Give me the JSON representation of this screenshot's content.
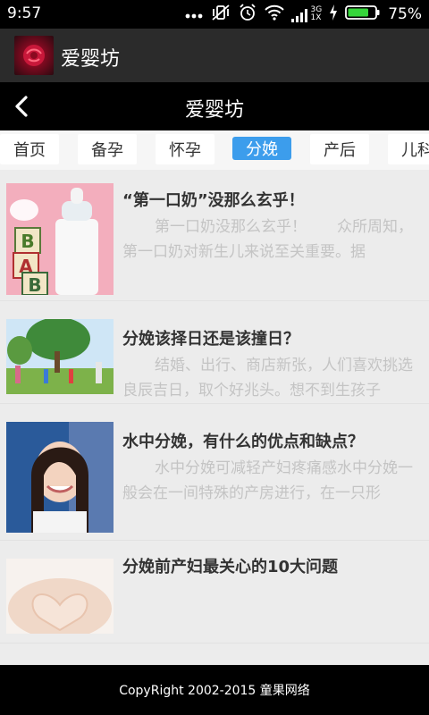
{
  "status_bar": {
    "time": "9:57",
    "battery_percent": "75%",
    "network_label_top": "3G",
    "network_label_bottom": "1X"
  },
  "app_bar": {
    "title": "爱婴坊"
  },
  "nav_bar": {
    "title": "爱婴坊"
  },
  "tabs": [
    {
      "label": "首页",
      "active": false
    },
    {
      "label": "备孕",
      "active": false
    },
    {
      "label": "怀孕",
      "active": false
    },
    {
      "label": "分娩",
      "active": true
    },
    {
      "label": "产后",
      "active": false
    },
    {
      "label": "儿科",
      "active": false
    }
  ],
  "articles": [
    {
      "title": "“第一口奶”没那么玄乎！",
      "desc": "第一口奶没那么玄乎！　　众所周知，第一口奶对新生儿来说至关重要。据",
      "image": "baby-bottle-blocks"
    },
    {
      "title": "分娩该择日还是该撞日？",
      "desc": "结婚、出行、商店新张，人们喜欢挑选良辰吉日，取个好兆头。想不到生孩子",
      "image": "family-under-tree"
    },
    {
      "title": "水中分娩，有什么的优点和缺点？",
      "desc": "水中分娩可减轻产妇疼痛感水中分娩一般会在一间特殊的产房进行，在一只形",
      "image": "smiling-woman"
    },
    {
      "title": "分娩前产妇最关心的10大问题",
      "desc": "",
      "image": "hands-heart-belly"
    }
  ],
  "footer": {
    "text": "CopyRight 2002-2015 童果网络"
  },
  "colors": {
    "active_tab": "#3c9dec",
    "app_bar": "#2b2b2b",
    "nav_bar": "#000000",
    "background": "#ececec"
  }
}
